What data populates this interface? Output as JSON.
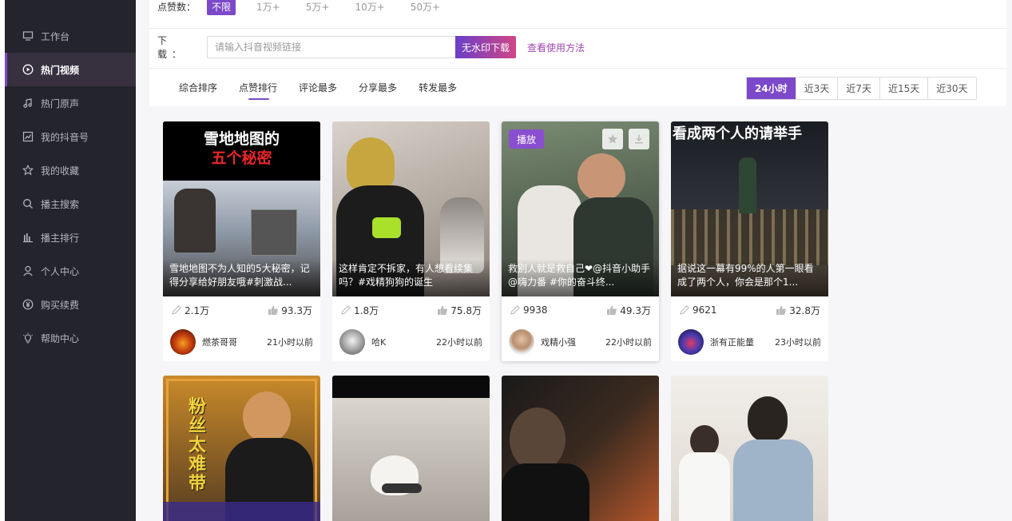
{
  "sidebar": {
    "items": [
      {
        "label": "工作台",
        "icon": "monitor-icon"
      },
      {
        "label": "热门视频",
        "icon": "play-circle-icon",
        "active": true
      },
      {
        "label": "热门原声",
        "icon": "music-note-icon"
      },
      {
        "label": "我的抖音号",
        "icon": "chart-image-icon"
      },
      {
        "label": "我的收藏",
        "icon": "star-icon"
      },
      {
        "label": "播主搜索",
        "icon": "search-icon"
      },
      {
        "label": "播主排行",
        "icon": "bar-chart-icon"
      },
      {
        "label": "个人中心",
        "icon": "user-icon"
      },
      {
        "label": "购买续费",
        "icon": "yen-circle-icon"
      },
      {
        "label": "帮助中心",
        "icon": "lightbulb-icon"
      }
    ]
  },
  "filters": {
    "fans_label": "点赞数：",
    "fans_options": [
      "不限",
      "1万+",
      "5万+",
      "10万+",
      "50万+"
    ],
    "download_label": "下 载：",
    "download_placeholder": "请输入抖音视频链接",
    "download_button": "无水印下载",
    "howto_link": "查看使用方法"
  },
  "sort_tabs": [
    "综合排序",
    "点赞排行",
    "评论最多",
    "分享最多",
    "转发最多"
  ],
  "active_sort": 1,
  "time_ranges": [
    "24小时",
    "近3天",
    "近7天",
    "近15天",
    "近30天"
  ],
  "active_time": 0,
  "colors": {
    "sidebar_bg": "#24242c",
    "accent": "#7b49c9",
    "download_gradient_end": "#d04786",
    "link": "#a046b0"
  },
  "cards": [
    {
      "thumb_title_1": "雪地地图的",
      "thumb_title_2": "五个秘密",
      "caption": "雪地地图不为人知的5大秘密，记得分享给好朋友哦#刺激战...",
      "comments": "2.1万",
      "likes": "93.3万",
      "author": "燃茶哥哥",
      "time": "21小时以前"
    },
    {
      "caption": "这样肯定不拆家，有人想看续集吗？#戏精狗狗的诞生",
      "comments": "1.8万",
      "likes": "75.8万",
      "author": "哈K",
      "time": "22小时以前"
    },
    {
      "badge": "播放",
      "caption": "救别人就是救自己❤@抖音小助手 @嗨力番 #你的奋斗终...",
      "comments": "9938",
      "likes": "49.3万",
      "author": "戏精小强",
      "time": "22小时以前"
    },
    {
      "thumb_title_1": "看成两个人的请举手",
      "caption": "据说这一幕有99%的人第一眼看成了两个人，你会是那个1...",
      "comments": "9621",
      "likes": "32.8万",
      "author": "浙有正能量",
      "time": "23小时以前"
    }
  ],
  "row2": [
    {
      "thumb_text": "粉丝太难带"
    },
    {
      "thumb_text": ""
    },
    {
      "thumb_text": ""
    },
    {
      "thumb_text": ""
    }
  ]
}
